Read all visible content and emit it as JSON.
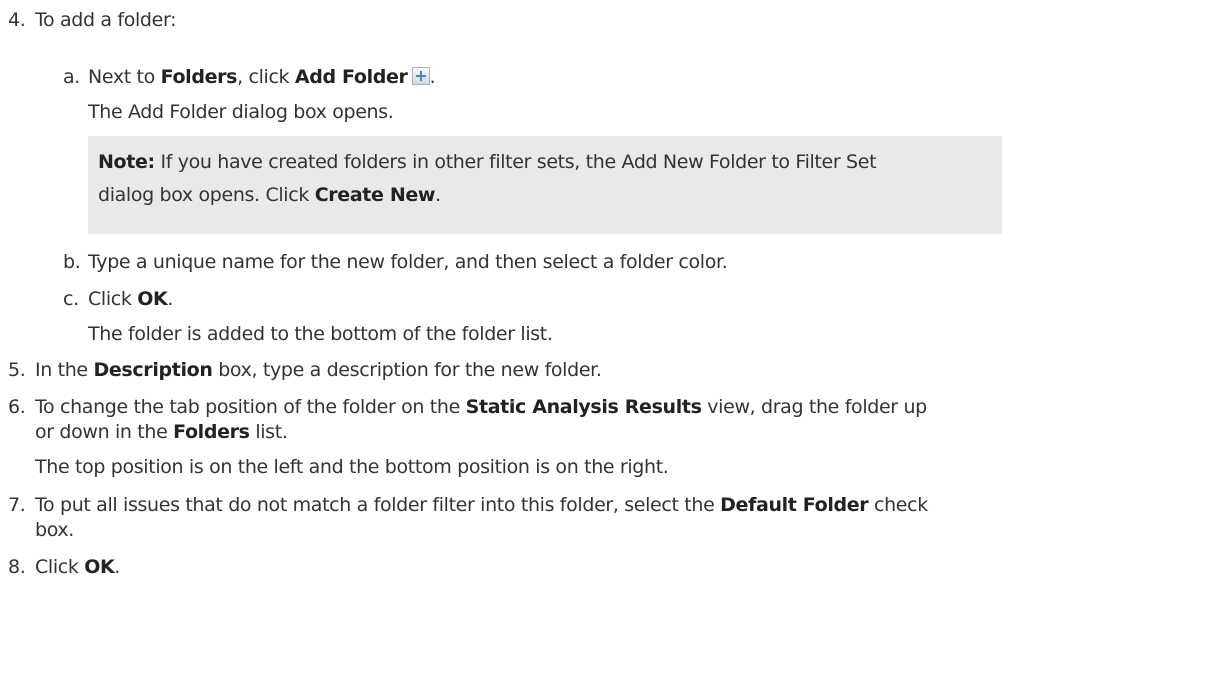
{
  "steps": {
    "s4": {
      "num": "4.",
      "text": "To add a folder:"
    },
    "s4a": {
      "num": "a.",
      "p1": "Next to ",
      "b1": "Folders",
      "p2": ", click ",
      "b2": "Add Folder",
      "p3": ".",
      "icon": "add-folder-icon",
      "result": "The Add Folder dialog box opens."
    },
    "note": {
      "label": "Note:",
      "line1": " If you have created folders in other filter sets, the Add New Folder to Filter Set",
      "line2a": "dialog box opens. Click ",
      "line2b": "Create New",
      "line2c": "."
    },
    "s4b": {
      "num": "b.",
      "text": "Type a unique name for the new folder, and then select a folder color."
    },
    "s4c": {
      "num": "c.",
      "p1": "Click ",
      "b1": "OK",
      "p2": ".",
      "result": "The folder is added to the bottom of the folder list."
    },
    "s5": {
      "num": "5.",
      "p1": "In the ",
      "b1": "Description",
      "p2": " box, type a description for the new folder."
    },
    "s6": {
      "num": "6.",
      "p1": "To change the tab position of the folder on the ",
      "b1": "Static Analysis Results",
      "p2": " view, drag the folder up",
      "p3": "or down in the ",
      "b2": "Folders",
      "p4": " list.",
      "result": "The top position is on the left and the bottom position is on the right."
    },
    "s7": {
      "num": "7.",
      "p1": "To put all issues that do not match a folder filter into this folder, select the ",
      "b1": "Default Folder",
      "p2": " check",
      "p3": "box."
    },
    "s8": {
      "num": "8.",
      "p1": "Click ",
      "b1": "OK",
      "p2": "."
    }
  },
  "colors": {
    "text": "#333333",
    "note_bg": "#e8e9e9",
    "icon_accent": "#3f86c6"
  }
}
